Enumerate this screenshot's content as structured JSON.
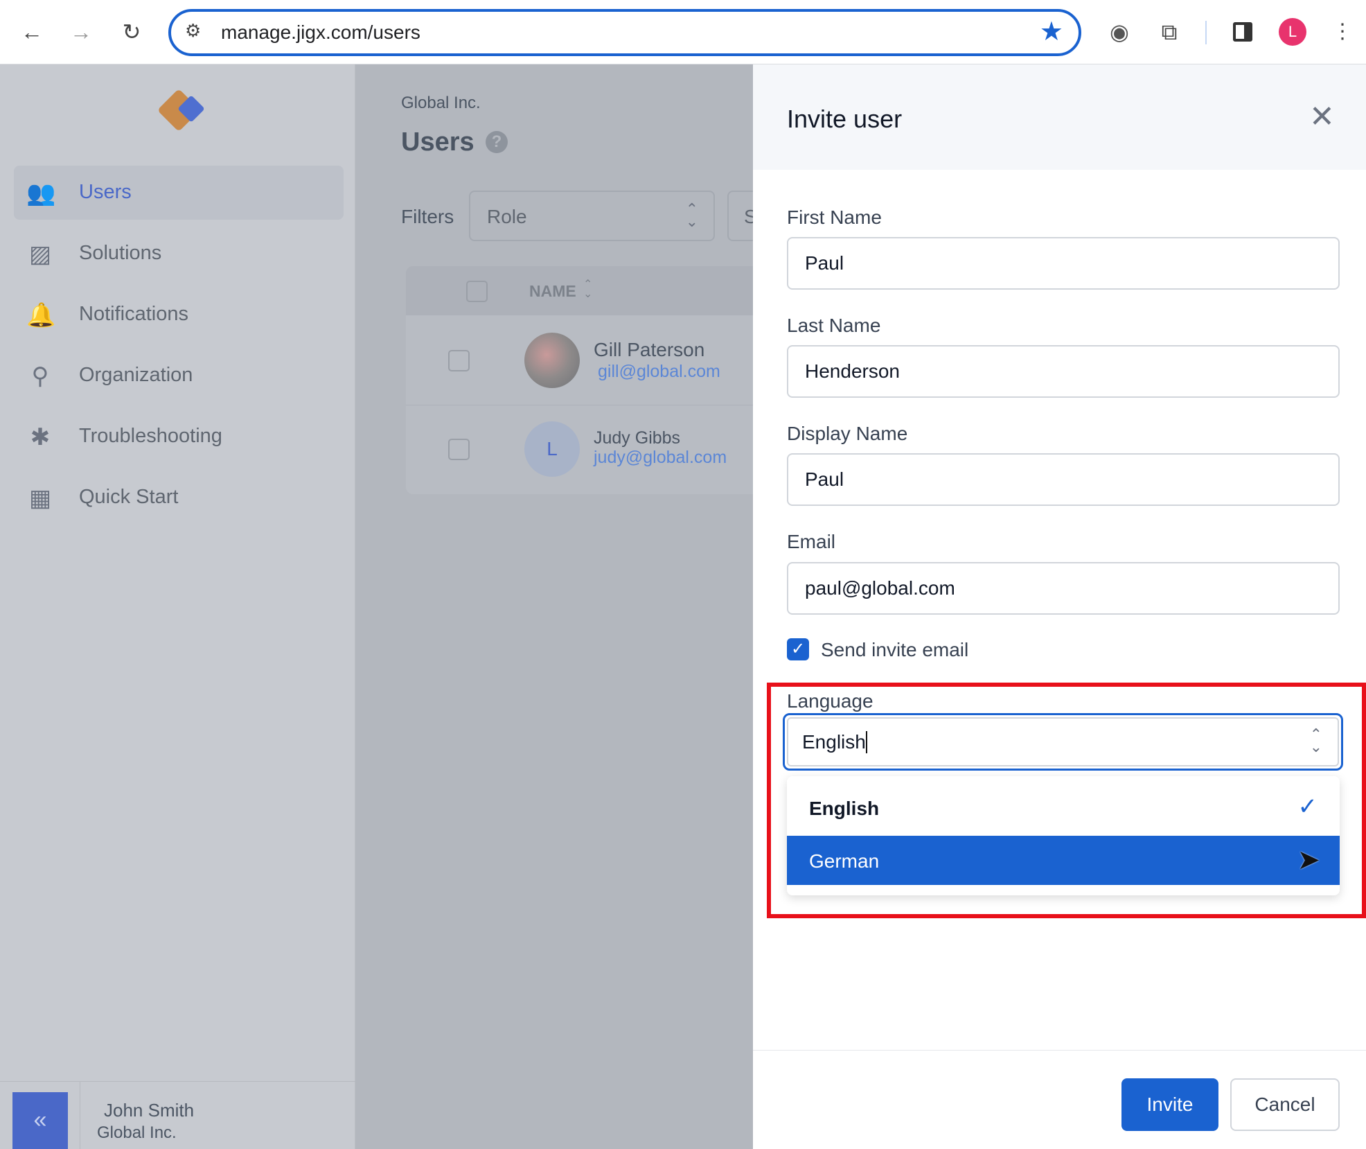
{
  "browser": {
    "url": "manage.jigx.com/users",
    "avatar_letter": "L",
    "colors": {
      "accent": "#1a62d0",
      "avatar": "#e8336d"
    }
  },
  "sidebar": {
    "items": [
      {
        "label": "Users",
        "icon": "users-icon",
        "active": true
      },
      {
        "label": "Solutions",
        "icon": "image-icon"
      },
      {
        "label": "Notifications",
        "icon": "bell-icon"
      },
      {
        "label": "Organization",
        "icon": "org-chart-icon"
      },
      {
        "label": "Troubleshooting",
        "icon": "bug-icon"
      },
      {
        "label": "Quick Start",
        "icon": "quick-start-icon"
      }
    ],
    "user": {
      "name": "John Smith",
      "org": "Global Inc."
    }
  },
  "main": {
    "org": "Global Inc.",
    "title": "Users",
    "filters_label": "Filters",
    "role_filter": "Role",
    "second_filter": "S",
    "table": {
      "name_header": "NAME",
      "rows": [
        {
          "name": "Gill Paterson",
          "email": "gill@global.com"
        },
        {
          "name": "Judy Gibbs",
          "email": "judy@global.com",
          "initial": "L"
        }
      ]
    }
  },
  "panel": {
    "title": "Invite user",
    "fields": {
      "first_name": {
        "label": "First Name",
        "value": "Paul"
      },
      "last_name": {
        "label": "Last Name",
        "value": "Henderson"
      },
      "display_name": {
        "label": "Display Name",
        "value": "Paul"
      },
      "email": {
        "label": "Email",
        "value": "paul@global.com"
      }
    },
    "send_invite": {
      "label": "Send invite email",
      "checked": true
    },
    "language": {
      "label": "Language",
      "value": "English",
      "options": [
        {
          "label": "English",
          "selected": true
        },
        {
          "label": "German",
          "highlighted": true
        }
      ]
    },
    "invite_label": "Invite",
    "cancel_label": "Cancel"
  }
}
